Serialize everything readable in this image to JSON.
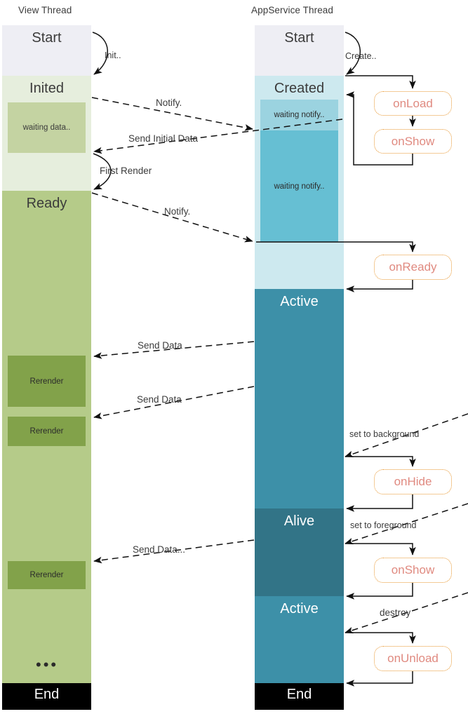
{
  "columns": [
    {
      "title": "View Thread"
    },
    {
      "title": "AppService Thread"
    }
  ],
  "view_thread": {
    "title": "View Thread",
    "states": [
      {
        "name": "Start",
        "color": "#eeeef4",
        "text_color": "#3b3b3b"
      },
      {
        "name": "Inited",
        "color": "#e6eedd",
        "text_color": "#3b3b3b"
      },
      {
        "name": "Ready",
        "color": "#b5cb89",
        "text_color": "#3b3b3b"
      },
      {
        "name": "End",
        "color": "#000000",
        "text_color": "#ffffff"
      }
    ],
    "inner_blocks": [
      {
        "name": "waiting data..",
        "color": "#c4d3a2",
        "text_color": "#3b3b3b"
      },
      {
        "name": "Rerender",
        "color": "#82a24a",
        "text_color": "#2b2b2b"
      },
      {
        "name": "Rerender",
        "color": "#82a24a",
        "text_color": "#2b2b2b"
      },
      {
        "name": "Rerender",
        "color": "#82a24a",
        "text_color": "#2b2b2b"
      }
    ],
    "ellipsis": "•••"
  },
  "appservice_thread": {
    "title": "AppService Thread",
    "states": [
      {
        "name": "Start",
        "color": "#eeeef4",
        "text_color": "#3b3b3b"
      },
      {
        "name": "Created",
        "color": "#cde9ef",
        "text_color": "#3b3b3b"
      },
      {
        "name": "Active",
        "color": "#3d90a8",
        "text_color": "#ffffff"
      },
      {
        "name": "Alive",
        "color": "#327487",
        "text_color": "#ffffff"
      },
      {
        "name": "Active",
        "color": "#3d90a8",
        "text_color": "#ffffff"
      },
      {
        "name": "End",
        "color": "#000000",
        "text_color": "#ffffff"
      }
    ],
    "inner_blocks": [
      {
        "name": "waiting notify..",
        "color": "#9bd3e0",
        "text_color": "#2b2b2b"
      },
      {
        "name": "waiting notify..",
        "color": "#66bfd3",
        "text_color": "#2b2b2b"
      }
    ]
  },
  "lifecycle_hooks": [
    {
      "name": "onLoad"
    },
    {
      "name": "onShow"
    },
    {
      "name": "onReady"
    },
    {
      "name": "onHide"
    },
    {
      "name": "onShow"
    },
    {
      "name": "onUnload"
    }
  ],
  "messages": [
    {
      "name": "Init.."
    },
    {
      "name": "Create.."
    },
    {
      "name": "Notify."
    },
    {
      "name": "Send Initial Data"
    },
    {
      "name": "First Render"
    },
    {
      "name": "Notify."
    },
    {
      "name": "Send Data"
    },
    {
      "name": "Send Data"
    },
    {
      "name": "set to background"
    },
    {
      "name": "set to foreground"
    },
    {
      "name": "Send Data..."
    },
    {
      "name": "destroy"
    }
  ],
  "colors": {
    "hook_border": "#e8962e",
    "hook_text": "#e08a80",
    "arrow": "#111111",
    "text": "#3b3b3b"
  }
}
